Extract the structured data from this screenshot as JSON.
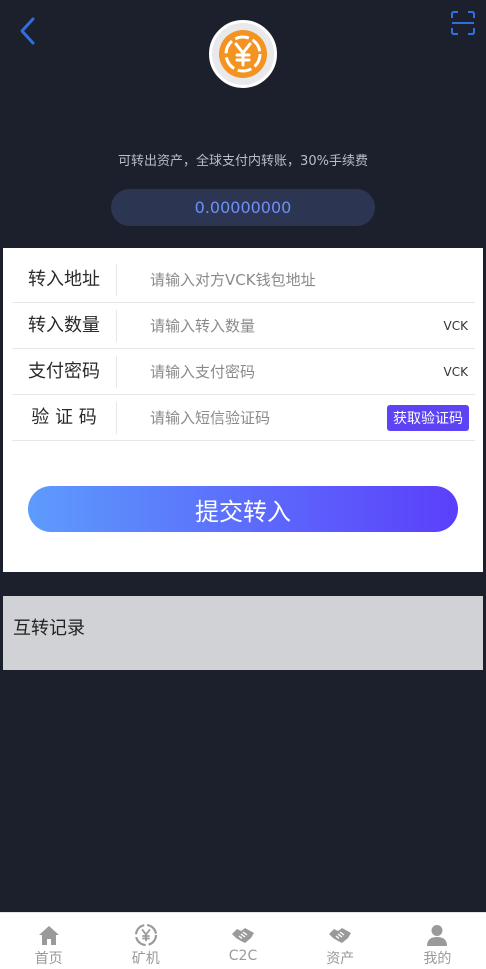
{
  "header": {
    "back_icon": "back-arrow-icon",
    "scan_icon": "scan-icon",
    "logo_icon": "yuan-coin-icon"
  },
  "hero": {
    "subtitle": "可转出资产，全球支付内转账，30%手续费",
    "balance": "0.00000000"
  },
  "form": {
    "rows": [
      {
        "label": "转入地址",
        "placeholder": "请输入对方VCK钱包地址",
        "value": ""
      },
      {
        "label": "转入数量",
        "placeholder": "请输入转入数量",
        "value": "",
        "unit": "VCK"
      },
      {
        "label": "支付密码",
        "placeholder": "请输入支付密码",
        "value": "",
        "unit": "VCK"
      },
      {
        "label": "验 证 码",
        "placeholder": "请输入短信验证码",
        "value": "",
        "action": "获取验证码"
      }
    ],
    "submit_label": "提交转入"
  },
  "records": {
    "title": "互转记录"
  },
  "tabbar": {
    "tabs": [
      {
        "label": "首页",
        "icon": "home-icon"
      },
      {
        "label": "矿机",
        "icon": "miner-icon"
      },
      {
        "label": "C2C",
        "icon": "handshake-icon"
      },
      {
        "label": "资产",
        "icon": "handshake-icon"
      },
      {
        "label": "我的",
        "icon": "user-icon"
      }
    ]
  },
  "colors": {
    "background": "#1c202d",
    "accent": "#5c43f4",
    "balance_text": "#6e8ff5",
    "icon_blue": "#2f6fe0",
    "coin_orange": "#f39322"
  }
}
